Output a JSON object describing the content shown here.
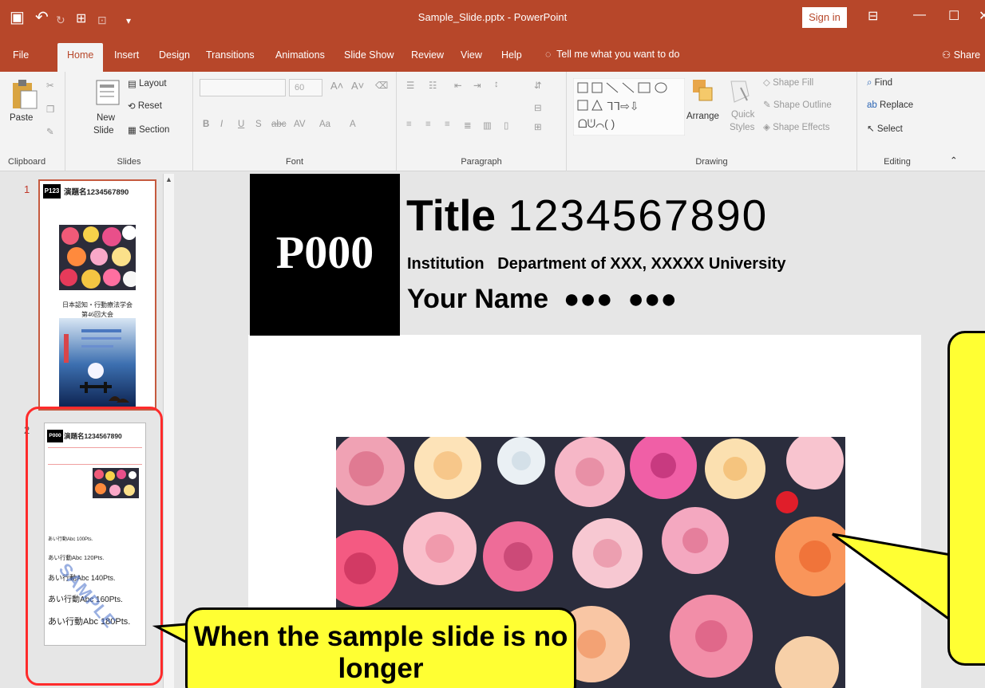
{
  "window": {
    "title": "Sample_Slide.pptx - PowerPoint",
    "sign_in": "Sign in"
  },
  "tabs": [
    "File",
    "Home",
    "Insert",
    "Design",
    "Transitions",
    "Animations",
    "Slide Show",
    "Review",
    "View",
    "Help"
  ],
  "tell_me": "Tell me what you want to do",
  "share": "Share",
  "ribbon": {
    "clipboard": {
      "label": "Clipboard",
      "paste": "Paste"
    },
    "slides": {
      "label": "Slides",
      "new_slide_1": "New",
      "new_slide_2": "Slide",
      "layout": "Layout",
      "reset": "Reset",
      "section": "Section"
    },
    "font": {
      "label": "Font",
      "size": "60"
    },
    "paragraph": {
      "label": "Paragraph"
    },
    "drawing": {
      "label": "Drawing",
      "arrange": "Arrange",
      "quick_styles_1": "Quick",
      "quick_styles_2": "Styles",
      "shape_fill": "Shape Fill",
      "shape_outline": "Shape Outline",
      "shape_effects": "Shape Effects"
    },
    "editing": {
      "label": "Editing",
      "find": "Find",
      "replace": "Replace",
      "select": "Select"
    }
  },
  "thumbnails": {
    "slide1_num": "1",
    "slide1_title": "演題名1234567890",
    "slide1_p": "P123",
    "slide1_event_1": "日本認知・行動療法学会",
    "slide1_event_2": "第46回大会",
    "slide2_num": "2",
    "slide2_title": "演題名1234567890",
    "slide2_p": "P000",
    "slide2_rows": [
      "あい行動Abc 100Pts.",
      "あい行動Abc 120Pts.",
      "あい行動Abc 140Pts.",
      "あい行動Abc 160Pts.",
      "あい行動Abc 180Pts."
    ],
    "slide2_watermark": "SAMPLE"
  },
  "slide": {
    "poster_number": "P000",
    "title_word": "Title",
    "title_number": "1234567890",
    "institution": "Institution   Department of XXX, XXXXX University",
    "your_name": "Your Name  ●●●  ●●●"
  },
  "callout_text": "When the sample slide is no longer",
  "colors": {
    "accent": "#b7472a",
    "callout": "#ffff33",
    "highlight_frame": "#ff2b2b"
  }
}
